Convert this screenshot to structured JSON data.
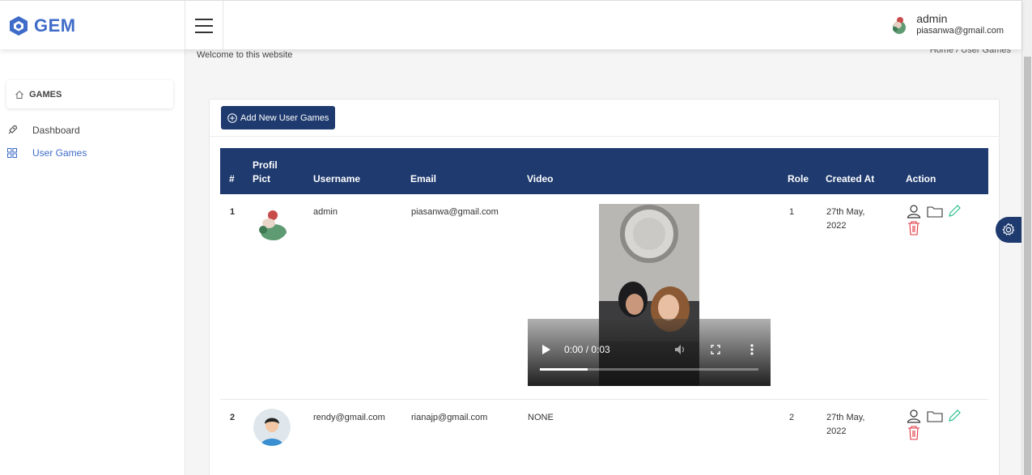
{
  "brand": {
    "name": "GEM"
  },
  "header": {
    "user_name": "admin",
    "user_email": "piasanwa@gmail.com"
  },
  "sidebar": {
    "section_label": "GAMES",
    "items": [
      {
        "label": "Dashboard",
        "icon": "rocket-icon"
      },
      {
        "label": "User Games",
        "icon": "grid-icon"
      }
    ]
  },
  "page": {
    "welcome": "Welcome to this website",
    "breadcrumb": "Home  /  User Games"
  },
  "toolbar": {
    "add_label": "Add New User Games"
  },
  "table": {
    "headers": {
      "num": "#",
      "pict_line1": "Profil",
      "pict_line2": "Pict",
      "username": "Username",
      "email": "Email",
      "video": "Video",
      "role": "Role",
      "created": "Created At",
      "action": "Action"
    },
    "rows": [
      {
        "num": "1",
        "username": "admin",
        "email": "piasanwa@gmail.com",
        "video_time": "0:00 / 0:03",
        "video_progress": 0.22,
        "role": "1",
        "created_l1": "27th May,",
        "created_l2": "2022"
      },
      {
        "num": "2",
        "username": "rendy@gmail.com",
        "email": "rianajp@gmail.com",
        "video": "NONE",
        "role": "2",
        "created_l1": "27th May,",
        "created_l2": "2022"
      }
    ]
  },
  "colors": {
    "primary": "#1e3a6e",
    "accent": "#3f6cc9",
    "edit": "#2bbf8a",
    "delete": "#e0343f"
  }
}
